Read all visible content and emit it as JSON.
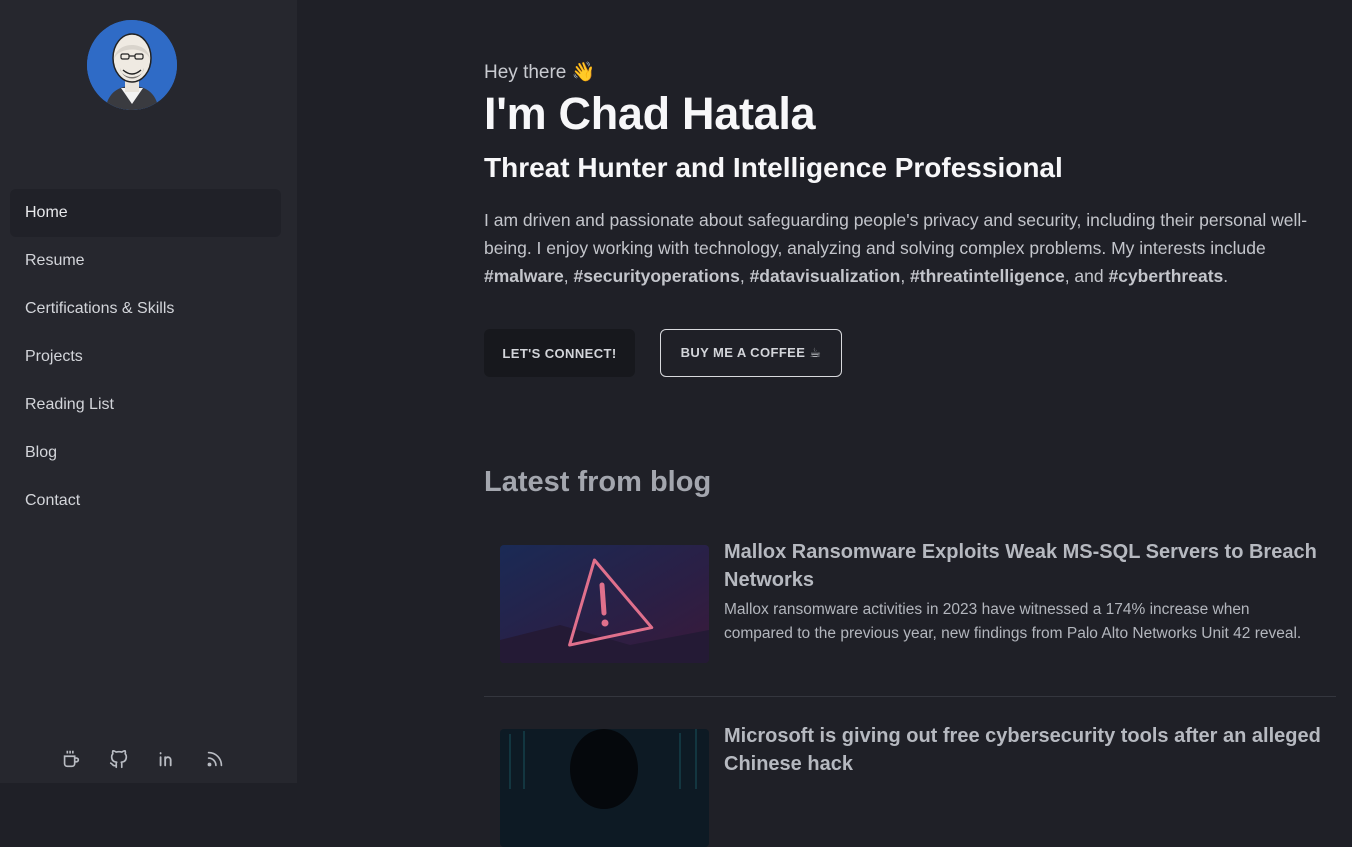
{
  "sidebar": {
    "nav": [
      {
        "label": "Home",
        "active": true
      },
      {
        "label": "Resume"
      },
      {
        "label": "Certifications & Skills"
      },
      {
        "label": "Projects"
      },
      {
        "label": "Reading List"
      },
      {
        "label": "Blog"
      },
      {
        "label": "Contact"
      }
    ],
    "social_icons": [
      "coffee-icon",
      "github-icon",
      "linkedin-icon",
      "rss-icon"
    ]
  },
  "hero": {
    "greeting": "Hey there 👋",
    "name": "I'm Chad Hatala",
    "role": "Threat Hunter and Intelligence Professional",
    "intro_text": "I am driven and passionate about safeguarding people's privacy and security, including their personal well-being. I enjoy working with technology, analyzing and solving complex problems. My interests include",
    "tags": [
      "#malware",
      "#securityoperations",
      "#datavisualization",
      "#threatintelligence",
      "#cyberthreats"
    ],
    "connect_label": "LET'S CONNECT!",
    "coffee_label": "BUY ME A COFFEE ☕"
  },
  "blog": {
    "title": "Latest from blog",
    "posts": [
      {
        "title": "Mallox Ransomware Exploits Weak MS-SQL Servers to Breach Networks",
        "description": "Mallox ransomware activities in 2023 have witnessed a 174% increase when compared to the previous year, new findings from Palo Alto Networks Unit 42 reveal."
      },
      {
        "title": "Microsoft is giving out free cybersecurity tools after an alleged Chinese hack",
        "description": ""
      }
    ]
  },
  "colors": {
    "background": "#1f2027",
    "sidebar": "#26272e",
    "avatar_bg": "#2f6bc6"
  }
}
